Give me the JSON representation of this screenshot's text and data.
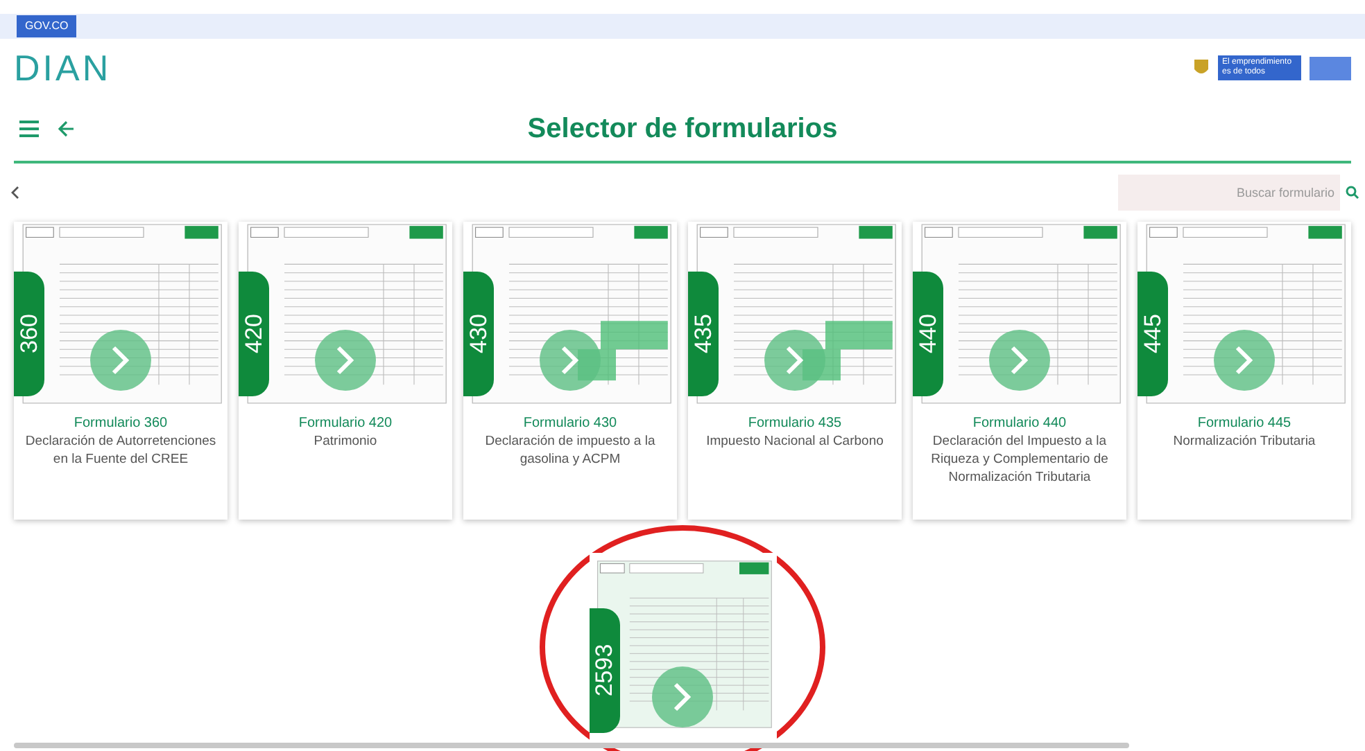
{
  "top_bar": {
    "badge": "GOV.CO"
  },
  "header": {
    "logo": "DIAN",
    "gov_logo": "El emprendimiento es de todos"
  },
  "title": "Selector de formularios",
  "search": {
    "placeholder": "Buscar formulario"
  },
  "forms": [
    {
      "number": "360",
      "title": "Formulario 360",
      "description": "Declaración de Autorretenciones en la Fuente del CREE",
      "highlight": false
    },
    {
      "number": "420",
      "title": "Formulario 420",
      "description": "Patrimonio",
      "highlight": false
    },
    {
      "number": "430",
      "title": "Formulario 430",
      "description": "Declaración de impuesto a la gasolina y ACPM",
      "highlight": true
    },
    {
      "number": "435",
      "title": "Formulario 435",
      "description": "Impuesto Nacional al Carbono",
      "highlight": true
    },
    {
      "number": "440",
      "title": "Formulario 440",
      "description": "Declaración del Impuesto a la Riqueza y Complementario de Normalización Tributaria",
      "highlight": false
    },
    {
      "number": "445",
      "title": "Formulario 445",
      "description": "Normalización Tributaria",
      "highlight": false
    }
  ],
  "featured_form": {
    "number": "2593",
    "circled": true
  }
}
